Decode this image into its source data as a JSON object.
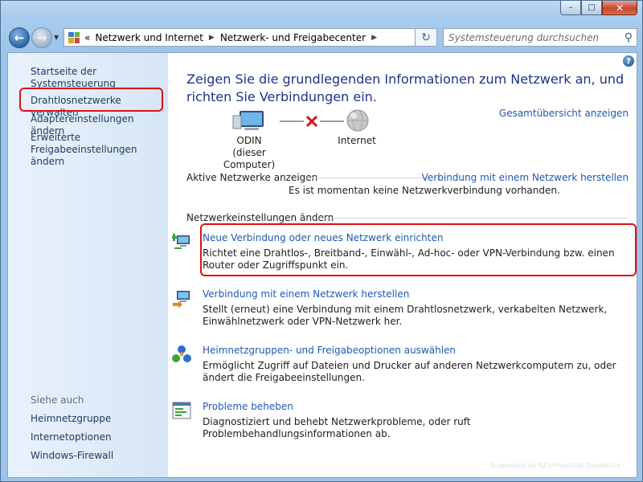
{
  "window": {
    "caption_buttons": {
      "minimize": "–",
      "maximize": "□",
      "close": "✕"
    }
  },
  "address_bar": {
    "overflow": "«",
    "crumbs": [
      "Netzwerk und Internet",
      "Netzwerk- und Freigabecenter"
    ]
  },
  "search": {
    "placeholder": "Systemsteuerung durchsuchen"
  },
  "sidebar": {
    "items": [
      {
        "label": "Startseite der Systemsteuerung"
      },
      {
        "label": "Drahtlosnetzwerke verwalten"
      },
      {
        "label": "Adaptereinstellungen ändern"
      },
      {
        "label": "Erweiterte Freigabeeinstellungen ändern"
      }
    ],
    "see_also_label": "Siehe auch",
    "see_also": [
      {
        "label": "Heimnetzgruppe"
      },
      {
        "label": "Internetoptionen"
      },
      {
        "label": "Windows-Firewall"
      }
    ]
  },
  "main": {
    "help_label": "?",
    "title": "Zeigen Sie die grundlegenden Informationen zum Netzwerk an, und richten Sie Verbindungen ein.",
    "full_map_link": "Gesamtübersicht anzeigen",
    "network_map": {
      "computer_name": "ODIN",
      "computer_sub": "(dieser Computer)",
      "internet_label": "Internet",
      "status": "disconnected"
    },
    "active_networks": {
      "heading": "Aktive Netzwerke anzeigen",
      "connect_link": "Verbindung mit einem Netzwerk herstellen",
      "none_text": "Es ist momentan keine Netzwerkverbindung vorhanden."
    },
    "settings_heading": "Netzwerkeinstellungen ändern",
    "tasks": [
      {
        "icon": "new-connection-icon",
        "title": "Neue Verbindung oder neues Netzwerk einrichten",
        "desc": "Richtet eine Drahtlos-, Breitband-, Einwähl-, Ad-hoc- oder VPN-Verbindung bzw. einen Router oder Zugriffspunkt ein."
      },
      {
        "icon": "connect-network-icon",
        "title": "Verbindung mit einem Netzwerk herstellen",
        "desc": "Stellt (erneut) eine Verbindung mit einem Drahtlosnetzwerk, verkabelten Netzwerk, Einwählnetzwerk oder VPN-Netzwerk her."
      },
      {
        "icon": "homegroup-icon",
        "title": "Heimnetzgruppen- und Freigabeoptionen auswählen",
        "desc": "Ermöglicht Zugriff auf Dateien und Drucker auf anderen Netzwerkcomputern zu, oder ändert die Freigabeeinstellungen."
      },
      {
        "icon": "troubleshoot-icon",
        "title": "Probleme beheben",
        "desc": "Diagnostiziert und behebt Netzwerkprobleme, oder ruft Problembehandlungsinformationen ab."
      }
    ]
  },
  "watermark": "Screenshot by RZ Universität Osnabrück",
  "colors": {
    "link": "#1e5ab4",
    "title": "#1e3287",
    "highlight": "#e01010",
    "sidebar_bg": "#e2eefa"
  }
}
